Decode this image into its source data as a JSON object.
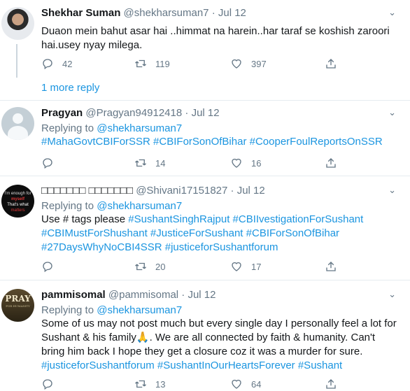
{
  "colors": {
    "link": "#1b95e0",
    "muted": "#657786",
    "text": "#14171a",
    "divider": "#e6ecf0"
  },
  "more_reply": "1 more reply",
  "tweets": [
    {
      "name": "Shekhar Suman",
      "handle": "@shekharsuman7",
      "dot": "·",
      "date": "Jul 12",
      "reply_prefix": "",
      "reply_handle": "",
      "lines": [
        "Duaon mein bahut asar hai ..himmat na harein..har taraf se koshish zaroori",
        "hai.usey nyay milega."
      ],
      "replies": "42",
      "retweets": "119",
      "likes": "397"
    },
    {
      "name": "Pragyan",
      "handle": "@Pragyan94912418",
      "dot": "·",
      "date": "Jul 12",
      "reply_prefix": "Replying to",
      "reply_handle": "@shekharsuman7",
      "lines": [
        "#MahaGovtCBIForSSR #CBIForSonOfBihar #CooperFoulReportsOnSSR"
      ],
      "replies": "",
      "retweets": "14",
      "likes": "16"
    },
    {
      "name": "□□□□□□□ □□□□□□□",
      "handle": "@Shivani17151827",
      "dot": "·",
      "date": "Jul 12",
      "reply_prefix": "Replying to",
      "reply_handle": "@shekharsuman7",
      "line1_prefix": "Use # tags please",
      "line1_tags": "#SushantSinghRajput #CBIIvestigationForSushant",
      "lines": [
        "#CBIMustForShushant #JusticeForSushant  #CBIForSonOfBihar",
        "#27DaysWhyNoCBI4SSR #justiceforSushantforum"
      ],
      "avatar_text": [
        "I'm enough for",
        "myself",
        "That's what",
        "matters"
      ],
      "replies": "",
      "retweets": "20",
      "likes": "17"
    },
    {
      "name": "pammisomal",
      "handle": "@pammisomal",
      "dot": "·",
      "date": "Jul 12",
      "reply_prefix": "Replying to",
      "reply_handle": "@shekharsuman7",
      "lines": [
        "Some of us may not post much but every single day I personally feel a lot for",
        "Sushant & his family🙏. We are all connected by faith & humanity. Can't",
        "bring him back I hope they get a closure coz it was a murder for sure."
      ],
      "tags_line": "#justiceforSushantforum #SushantInOurHeartsForever #Sushant",
      "avatar_text": [
        "PRAY",
        "FOR HUMANITY"
      ],
      "replies": "",
      "retweets": "13",
      "likes": "64"
    }
  ]
}
